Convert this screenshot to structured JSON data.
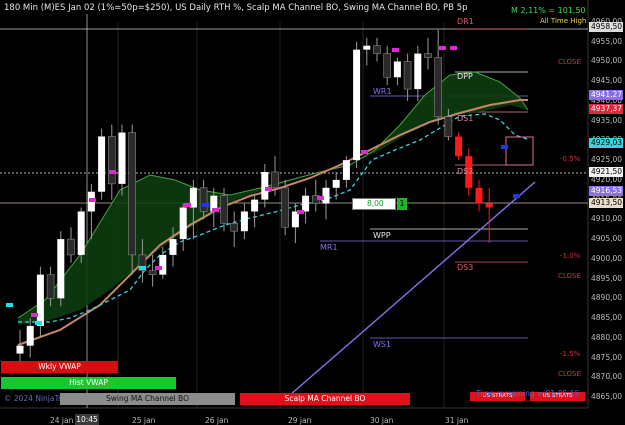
{
  "header": {
    "title": "180 Min (M)ES Jan 02 (1%=50p=$250), US Daily RTH %, Scalp MA Channel BO, Swing MA Channel BO, PB 5p",
    "m_stat": "M 2,11% = 101,50",
    "all_time_high": "All Time High"
  },
  "price_axis": {
    "ticks": [
      "4960,00",
      "4955,00",
      "4950,00",
      "4945,00",
      "4940,00",
      "4935,00",
      "4930,00",
      "4925,00",
      "4920,00",
      "4915,00",
      "4910,00",
      "4905,00",
      "4900,00",
      "4895,00",
      "4890,00",
      "4885,00",
      "4880,00",
      "4875,00",
      "4870,00",
      "4865,00"
    ],
    "tag_top": "4958,50",
    "tag_purple": "4941,27",
    "tag_red": "4937,37",
    "tag_cyan": "4929,03",
    "tag_white": "4921,50",
    "tag_blue": "4916,53",
    "tag_tan": "4913,50"
  },
  "x_axis": {
    "labels": [
      "24 jan",
      "25 jan",
      "26 jan",
      "29 jan",
      "30 jan",
      "31 jan"
    ],
    "cursor": "10:45"
  },
  "levels": {
    "dr1": "DR1",
    "dpp": "DPP",
    "wr1": "WR1",
    "ds1": "DS1",
    "ds2": "DS2",
    "ds3": "DS3",
    "wpp": "WPP",
    "mr1": "MR1",
    "ws1": "WS1",
    "close_1": "CLOSE",
    "close_2": "CLOSE",
    "close_3": "CLOSE",
    "pct_1": "-0.5%",
    "pct_2": "-1.0%",
    "pct_3": "-1.5%"
  },
  "order": {
    "value": "8,00",
    "qty": "1"
  },
  "bottom": {
    "wkly_vwap": "Wkly VWAP",
    "hist_vwap": "Hist VWAP",
    "copyright": "© 2024 NinjaTrader",
    "swing_btn": "Swing MA Channel BO",
    "scalp_btn": "Scalp MA Channel BO",
    "small_btn_1": "US STRATS",
    "small_btn_2": "US STRATS",
    "time_remaining": "Time remaining = 01:05:15"
  },
  "colors": {
    "bg": "#000000",
    "up_candle": "#ffffff",
    "down_candle": "#2b2b2b",
    "red_candle": "#ff1a1a",
    "channel_fill": "#0d3d10",
    "channel_edge": "#3fa53f",
    "ma_tan": "#c8866a",
    "cyan": "#35d5e0",
    "purple": "#8a6fe8",
    "wkly_red": "#d40f0f",
    "hist_green": "#16c82c"
  },
  "candles": [
    {
      "o": 4876,
      "h": 4882,
      "l": 4874,
      "c": 4878
    },
    {
      "o": 4878,
      "h": 4885,
      "l": 4875,
      "c": 4883
    },
    {
      "o": 4883,
      "h": 4898,
      "l": 4880,
      "c": 4896
    },
    {
      "o": 4896,
      "h": 4898,
      "l": 4888,
      "c": 4890
    },
    {
      "o": 4890,
      "h": 4907,
      "l": 4888,
      "c": 4905
    },
    {
      "o": 4905,
      "h": 4908,
      "l": 4899,
      "c": 4901
    },
    {
      "o": 4901,
      "h": 4913,
      "l": 4899,
      "c": 4912
    },
    {
      "o": 4912,
      "h": 4919,
      "l": 4905,
      "c": 4917
    },
    {
      "o": 4917,
      "h": 4933,
      "l": 4915,
      "c": 4931
    },
    {
      "o": 4931,
      "h": 4934,
      "l": 4915,
      "c": 4919
    },
    {
      "o": 4919,
      "h": 4934,
      "l": 4916,
      "c": 4932
    },
    {
      "o": 4932,
      "h": 4934,
      "l": 4896,
      "c": 4901
    },
    {
      "o": 4901,
      "h": 4905,
      "l": 4894,
      "c": 4897
    },
    {
      "o": 4897,
      "h": 4901,
      "l": 4893,
      "c": 4896
    },
    {
      "o": 4896,
      "h": 4903,
      "l": 4895,
      "c": 4901
    },
    {
      "o": 4901,
      "h": 4908,
      "l": 4898,
      "c": 4905
    },
    {
      "o": 4905,
      "h": 4914,
      "l": 4902,
      "c": 4913
    },
    {
      "o": 4913,
      "h": 4920,
      "l": 4905,
      "c": 4918
    },
    {
      "o": 4918,
      "h": 4920,
      "l": 4910,
      "c": 4912
    },
    {
      "o": 4912,
      "h": 4918,
      "l": 4908,
      "c": 4916
    },
    {
      "o": 4916,
      "h": 4918,
      "l": 4907,
      "c": 4909
    },
    {
      "o": 4909,
      "h": 4912,
      "l": 4903,
      "c": 4907
    },
    {
      "o": 4907,
      "h": 4914,
      "l": 4905,
      "c": 4912
    },
    {
      "o": 4912,
      "h": 4916,
      "l": 4908,
      "c": 4915
    },
    {
      "o": 4915,
      "h": 4924,
      "l": 4913,
      "c": 4922
    },
    {
      "o": 4922,
      "h": 4926,
      "l": 4916,
      "c": 4918
    },
    {
      "o": 4918,
      "h": 4920,
      "l": 4906,
      "c": 4908
    },
    {
      "o": 4908,
      "h": 4914,
      "l": 4904,
      "c": 4912
    },
    {
      "o": 4912,
      "h": 4918,
      "l": 4909,
      "c": 4916
    },
    {
      "o": 4916,
      "h": 4920,
      "l": 4912,
      "c": 4914
    },
    {
      "o": 4914,
      "h": 4920,
      "l": 4910,
      "c": 4918
    },
    {
      "o": 4918,
      "h": 4922,
      "l": 4915,
      "c": 4920
    },
    {
      "o": 4920,
      "h": 4926,
      "l": 4918,
      "c": 4925
    },
    {
      "o": 4925,
      "h": 4955,
      "l": 4923,
      "c": 4953
    },
    {
      "o": 4953,
      "h": 4956,
      "l": 4949,
      "c": 4954
    },
    {
      "o": 4954,
      "h": 4956,
      "l": 4950,
      "c": 4952
    },
    {
      "o": 4952,
      "h": 4954,
      "l": 4944,
      "c": 4946
    },
    {
      "o": 4946,
      "h": 4951,
      "l": 4944,
      "c": 4950
    },
    {
      "o": 4950,
      "h": 4952,
      "l": 4940,
      "c": 4943
    },
    {
      "o": 4943,
      "h": 4954,
      "l": 4940,
      "c": 4952
    },
    {
      "o": 4952,
      "h": 4956,
      "l": 4948,
      "c": 4951
    },
    {
      "o": 4951,
      "h": 4958,
      "l": 4934,
      "c": 4936
    },
    {
      "o": 4936,
      "h": 4938,
      "l": 4930,
      "c": 4931
    },
    {
      "o": 4931,
      "h": 4932,
      "l": 4925,
      "c": 4926
    },
    {
      "o": 4926,
      "h": 4928,
      "l": 4916,
      "c": 4918
    },
    {
      "o": 4918,
      "h": 4920,
      "l": 4912,
      "c": 4914
    },
    {
      "o": 4914,
      "h": 4918,
      "l": 4904,
      "c": 4913
    }
  ]
}
